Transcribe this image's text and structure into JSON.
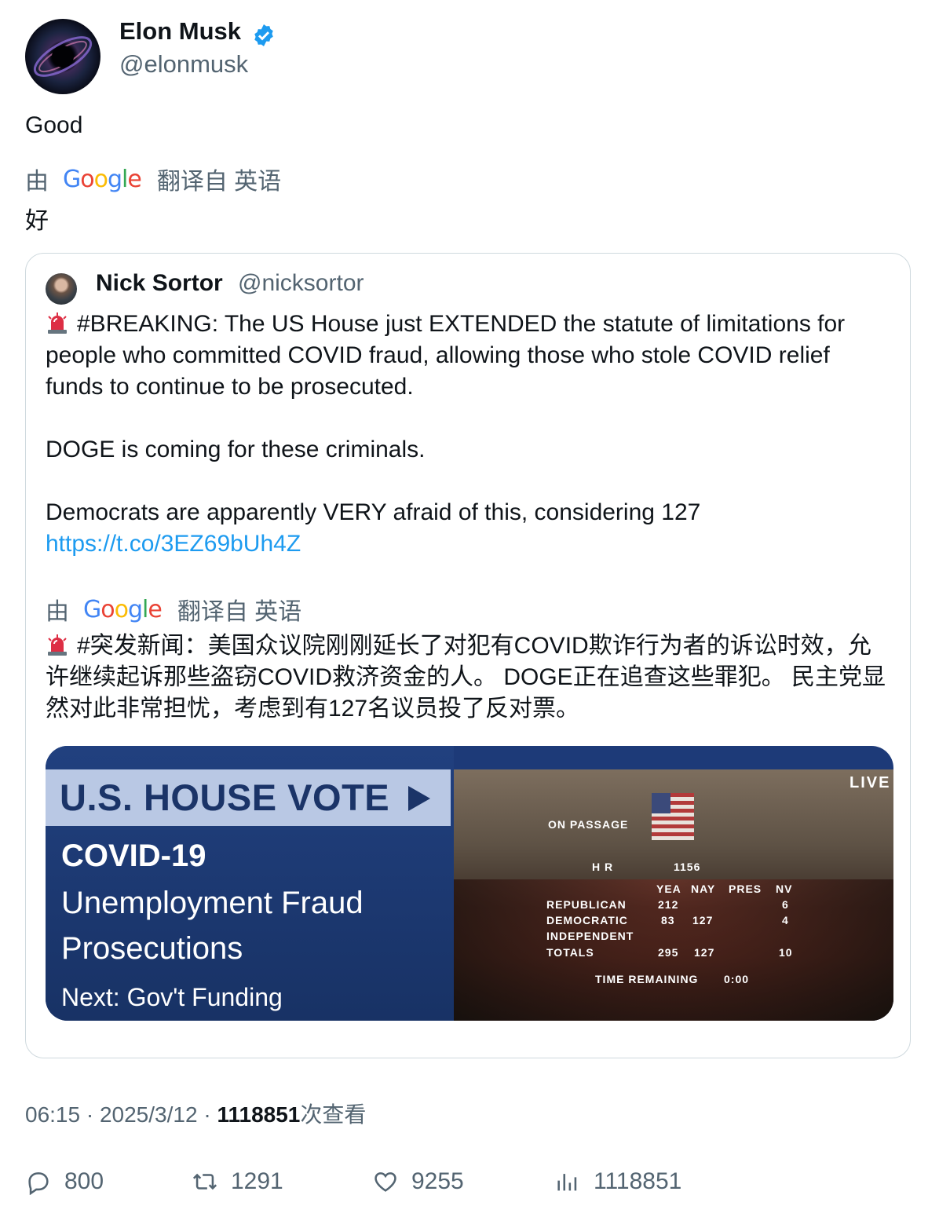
{
  "author": {
    "name": "Elon Musk",
    "handle": "@elonmusk",
    "verified_color": "#1d9bf0"
  },
  "tweet_text": "Good",
  "translation": {
    "by": "由",
    "brand": "Google",
    "from": "翻译自 英语",
    "text": "好"
  },
  "quoted": {
    "author": {
      "name": "Nick Sortor",
      "handle": "@nicksortor"
    },
    "lines": [
      "#BREAKING: The US House just EXTENDED the statute of limitations for people who committed COVID fraud, allowing those who stole COVID relief funds to continue to be prosecuted.",
      "DOGE is coming for these criminals.",
      "Democrats are apparently VERY afraid of this, considering 127"
    ],
    "link": "https://t.co/3EZ69bUh4Z",
    "translation": {
      "by": "由",
      "brand": "Google",
      "from": "翻译自 英语",
      "text": "#突发新闻：美国众议院刚刚延长了对犯有COVID欺诈行为者的诉讼时效，允许继续起诉那些盗窃COVID救济资金的人。 DOGE正在追查这些罪犯。 民主党显然对此非常担忧，考虑到有127名议员投了反对票。"
    },
    "media": {
      "banner": "U.S. HOUSE VOTE",
      "line1": "COVID-19",
      "line2": "Unemployment Fraud",
      "line3": "Prosecutions",
      "line4": "Next: Gov't Funding",
      "live": "LIVE",
      "on_passage": "ON PASSAGE",
      "bill_prefix": "H R",
      "bill_number": "1156",
      "col_yea": "YEA",
      "col_nay": "NAY",
      "col_pres": "PRES",
      "col_nv": "NV",
      "row_rep": "REPUBLICAN",
      "rep_yea": "212",
      "rep_nv": "6",
      "row_dem": "DEMOCRATIC",
      "dem_yea": "83",
      "dem_nay": "127",
      "dem_nv": "4",
      "row_ind": "INDEPENDENT",
      "row_tot": "TOTALS",
      "tot_yea": "295",
      "tot_nay": "127",
      "tot_nv": "10",
      "time_label": "TIME REMAINING",
      "time_value": "0:00"
    }
  },
  "meta": {
    "time": "06:15",
    "date": "2025/3/12",
    "views": "1118851",
    "views_label": "次查看"
  },
  "actions": {
    "replies": "800",
    "reposts": "1291",
    "likes": "9255",
    "views": "1118851"
  }
}
